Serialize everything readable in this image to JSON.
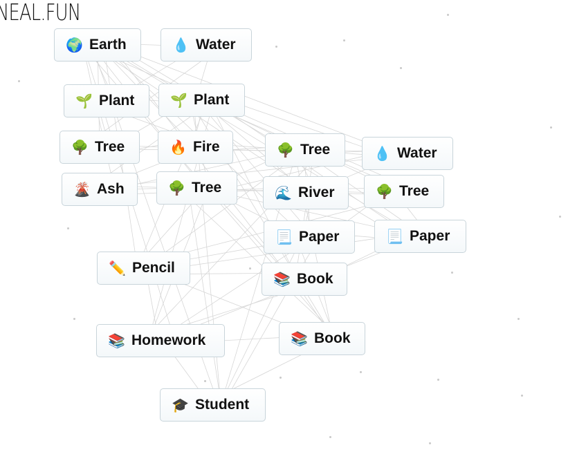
{
  "logo": "NEAL.FUN",
  "items": [
    {
      "label": "Earth",
      "icon": "globe-icon",
      "glyph": "🌍"
    },
    {
      "label": "Water",
      "icon": "droplet-icon",
      "glyph": "💧"
    },
    {
      "label": "Plant",
      "icon": "seedling-icon",
      "glyph": "🌱"
    },
    {
      "label": "Plant",
      "icon": "seedling-icon",
      "glyph": "🌱"
    },
    {
      "label": "Tree",
      "icon": "tree-icon",
      "glyph": "🌳"
    },
    {
      "label": "Fire",
      "icon": "fire-icon",
      "glyph": "🔥"
    },
    {
      "label": "Tree",
      "icon": "tree-icon",
      "glyph": "🌳"
    },
    {
      "label": "Water",
      "icon": "droplet-icon",
      "glyph": "💧"
    },
    {
      "label": "Ash",
      "icon": "volcano-icon",
      "glyph": "🌋"
    },
    {
      "label": "Tree",
      "icon": "tree-icon",
      "glyph": "🌳"
    },
    {
      "label": "River",
      "icon": "wave-icon",
      "glyph": "🌊"
    },
    {
      "label": "Tree",
      "icon": "tree-icon",
      "glyph": "🌳"
    },
    {
      "label": "Paper",
      "icon": "scroll-icon",
      "glyph": "📃"
    },
    {
      "label": "Paper",
      "icon": "scroll-icon",
      "glyph": "📃"
    },
    {
      "label": "Pencil",
      "icon": "pencil-icon",
      "glyph": "✏️"
    },
    {
      "label": "Book",
      "icon": "books-icon",
      "glyph": "📚"
    },
    {
      "label": "Homework",
      "icon": "books-icon",
      "glyph": "📚"
    },
    {
      "label": "Book",
      "icon": "books-icon",
      "glyph": "📚"
    },
    {
      "label": "Student",
      "icon": "graduation-cap-icon",
      "glyph": "🎓"
    }
  ]
}
